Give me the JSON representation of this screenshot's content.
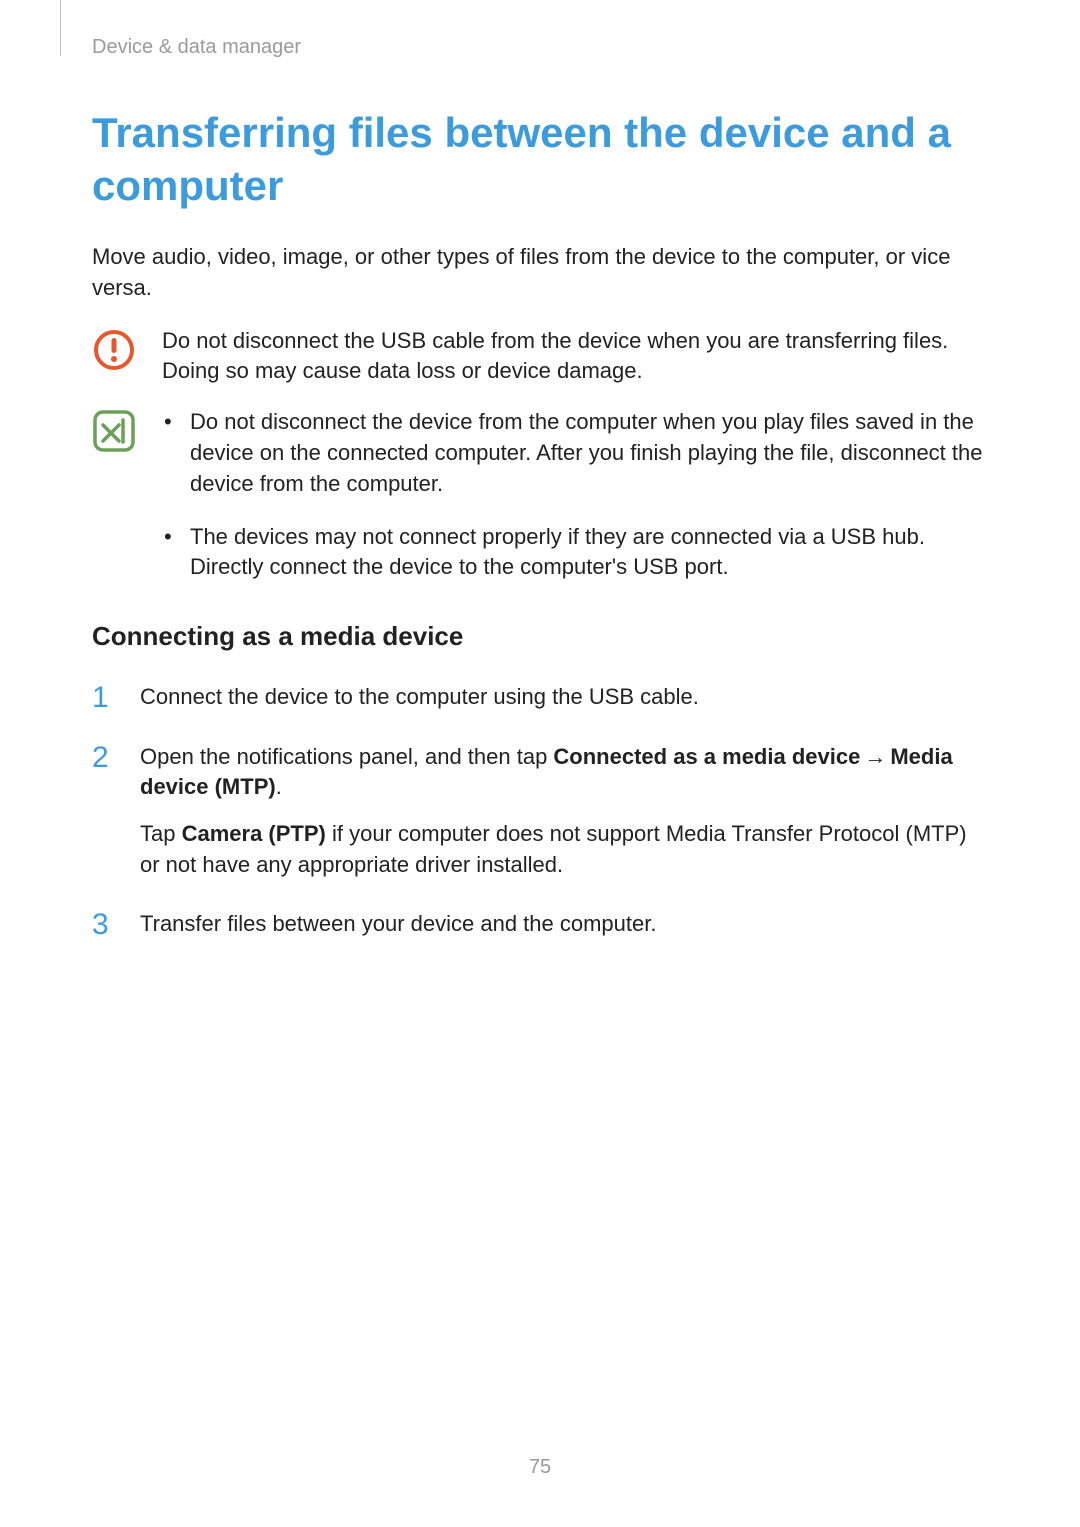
{
  "header": {
    "section_name": "Device & data manager"
  },
  "title": "Transferring files between the device and a computer",
  "intro": "Move audio, video, image, or other types of files from the device to the computer, or vice versa.",
  "caution_note": "Do not disconnect the USB cable from the device when you are transferring files. Doing so may cause data loss or device damage.",
  "info_bullets": [
    "Do not disconnect the device from the computer when you play files saved in the device on the connected computer. After you finish playing the file, disconnect the device from the computer.",
    "The devices may not connect properly if they are connected via a USB hub. Directly connect the device to the computer's USB port."
  ],
  "subheading": "Connecting as a media device",
  "steps": {
    "s1": {
      "num": "1",
      "text": "Connect the device to the computer using the USB cable."
    },
    "s2": {
      "num": "2",
      "p1_pre": "Open the notifications panel, and then tap ",
      "p1_bold1": "Connected as a media device",
      "p1_arrow": "→",
      "p1_bold2": "Media device (MTP)",
      "p1_post": ".",
      "p2_pre": "Tap ",
      "p2_bold": "Camera (PTP)",
      "p2_post": " if your computer does not support Media Transfer Protocol (MTP) or not have any appropriate driver installed."
    },
    "s3": {
      "num": "3",
      "text": "Transfer files between your device and the computer."
    }
  },
  "page_number": "75"
}
